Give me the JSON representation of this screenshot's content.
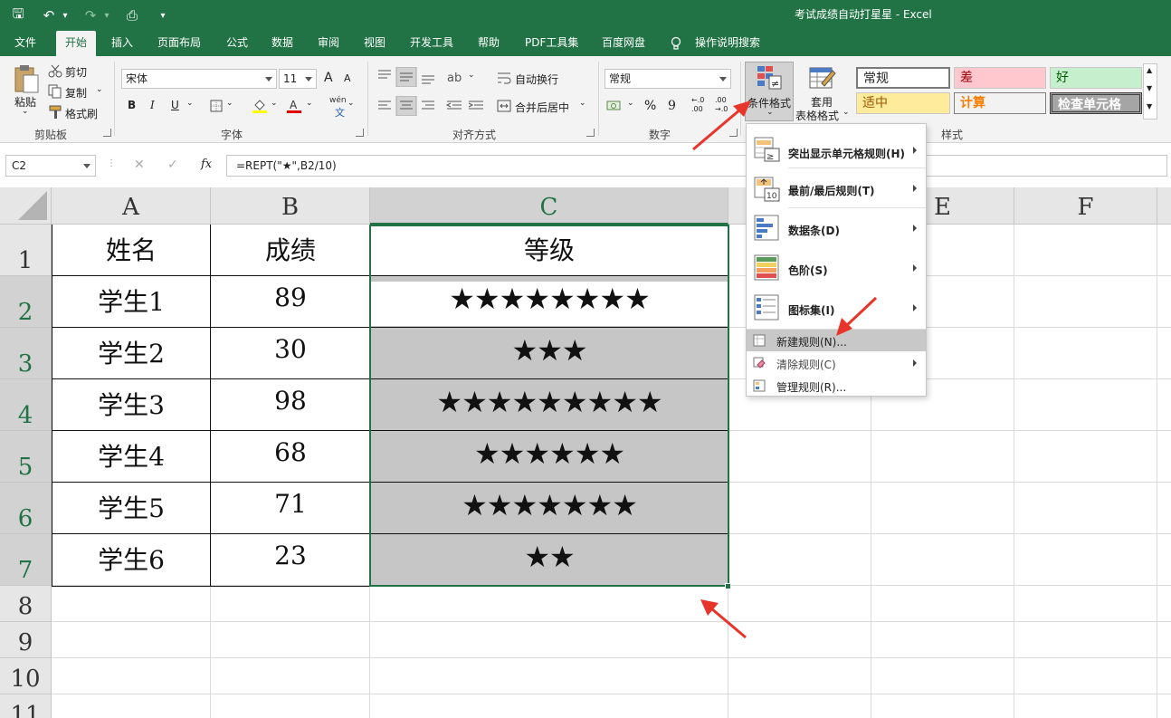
{
  "titlebar": {
    "title": "考试成绩自动打星星  -  Excel",
    "qat": {
      "save_glyph": "🖫",
      "undo_glyph": "↶",
      "undo_drop_glyph": "▾",
      "redo_glyph": "↷",
      "redo_drop_glyph": "▾",
      "preview_glyph": "⎙",
      "customize_glyph": "▾"
    }
  },
  "tabs": [
    {
      "label": "文件"
    },
    {
      "label": "开始"
    },
    {
      "label": "插入"
    },
    {
      "label": "页面布局"
    },
    {
      "label": "公式"
    },
    {
      "label": "数据"
    },
    {
      "label": "审阅"
    },
    {
      "label": "视图"
    },
    {
      "label": "开发工具"
    },
    {
      "label": "帮助"
    },
    {
      "label": "PDF工具集"
    },
    {
      "label": "百度网盘"
    },
    {
      "label": "操作说明搜索"
    }
  ],
  "ribbon": {
    "clipboard": {
      "paste": "粘贴",
      "cut": "剪切",
      "copy": "复制",
      "format_painter": "格式刷",
      "label": "剪贴板"
    },
    "font": {
      "name": "宋体",
      "size": "11",
      "grow": "A",
      "shrink": "A",
      "bold": "B",
      "italic": "I",
      "underline": "U",
      "wen": "wén",
      "label": "字体"
    },
    "alignment": {
      "wrap": "自动换行",
      "merge": "合并后居中",
      "label": "对齐方式"
    },
    "number": {
      "format": "常规",
      "percent": "%",
      "comma": "9",
      "dec_inc": "←.0\n.00",
      "dec_dec": ".00\n→.0",
      "label": "数字"
    },
    "styles": {
      "cond_format": "条件格式",
      "table_format_1": "套用",
      "table_format_2": "表格格式",
      "cells": [
        {
          "label": "常规"
        },
        {
          "label": "差"
        },
        {
          "label": "好"
        },
        {
          "label": "适中"
        },
        {
          "label": "计算"
        },
        {
          "label": "检查单元格"
        }
      ],
      "label": "样式"
    }
  },
  "formula_bar": {
    "name_box": "C2",
    "cancel": "✕",
    "enter": "✓",
    "fx": "fx",
    "formula": "=REPT(\"★\",B2/10)"
  },
  "sheet": {
    "columns": [
      "A",
      "B",
      "C",
      "",
      "E",
      "F"
    ],
    "rows": [
      "1",
      "2",
      "3",
      "4",
      "5",
      "6",
      "7",
      "8",
      "9",
      "10",
      "11"
    ],
    "header": {
      "name": "姓名",
      "score": "成绩",
      "grade": "等级"
    },
    "data": [
      {
        "name": "学生1",
        "score": "89",
        "stars": "★★★★★★★★"
      },
      {
        "name": "学生2",
        "score": "30",
        "stars": "★★★"
      },
      {
        "name": "学生3",
        "score": "98",
        "stars": "★★★★★★★★★"
      },
      {
        "name": "学生4",
        "score": "68",
        "stars": "★★★★★★"
      },
      {
        "name": "学生5",
        "score": "71",
        "stars": "★★★★★★★"
      },
      {
        "name": "学生6",
        "score": "23",
        "stars": "★★"
      }
    ]
  },
  "menu": {
    "items": [
      {
        "label": "突出显示单元格规则(H)"
      },
      {
        "label": "最前/最后规则(T)"
      },
      {
        "label": "数据条(D)"
      },
      {
        "label": "色阶(S)"
      },
      {
        "label": "图标集(I)"
      },
      {
        "label": "新建规则(N)..."
      },
      {
        "label": "清除规则(C)"
      },
      {
        "label": "管理规则(R)..."
      }
    ],
    "icon_text": {
      "gt": "≥",
      "ten": "10"
    }
  },
  "colors": {
    "excel_green": "#217346",
    "style_bad_bg": "#ffc7ce",
    "style_bad_fg": "#9c0006",
    "style_good_bg": "#c6efce",
    "style_good_fg": "#006100",
    "style_neutral_bg": "#ffeb9c",
    "style_neutral_fg": "#9c5700",
    "style_calc_bg": "#f2f2f2",
    "style_calc_fg": "#fa7d00",
    "style_check_bg": "#a5a5a5",
    "annotation_red": "#e8352b"
  }
}
